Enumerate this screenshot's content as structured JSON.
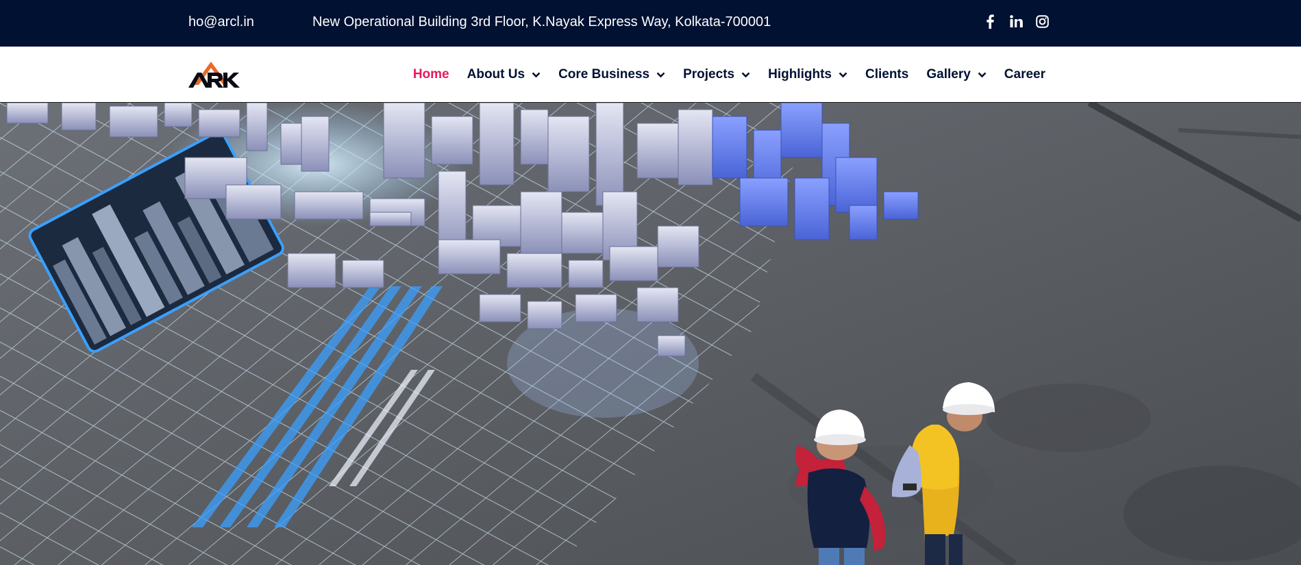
{
  "topbar": {
    "email": "ho@arcl.in",
    "address": "New Operational Building 3rd Floor, K.Nayak Express Way, Kolkata-700001",
    "social": [
      {
        "icon": "facebook-icon"
      },
      {
        "icon": "linkedin-icon"
      },
      {
        "icon": "instagram-icon"
      }
    ]
  },
  "brand": {
    "logo_text": "ARK",
    "accent": "#e86a2a"
  },
  "nav": {
    "items": [
      {
        "label": "Home",
        "active": true,
        "dropdown": false
      },
      {
        "label": "About Us",
        "active": false,
        "dropdown": true
      },
      {
        "label": "Core Business",
        "active": false,
        "dropdown": true
      },
      {
        "label": "Projects",
        "active": false,
        "dropdown": true
      },
      {
        "label": "Highlights",
        "active": false,
        "dropdown": true
      },
      {
        "label": "Clients",
        "active": false,
        "dropdown": false
      },
      {
        "label": "Gallery",
        "active": false,
        "dropdown": true
      },
      {
        "label": "Career",
        "active": false,
        "dropdown": false
      }
    ]
  },
  "colors": {
    "topbar_bg": "#011132",
    "nav_text": "#011132",
    "active": "#e8195a"
  },
  "hero": {
    "image": "hero-image"
  }
}
